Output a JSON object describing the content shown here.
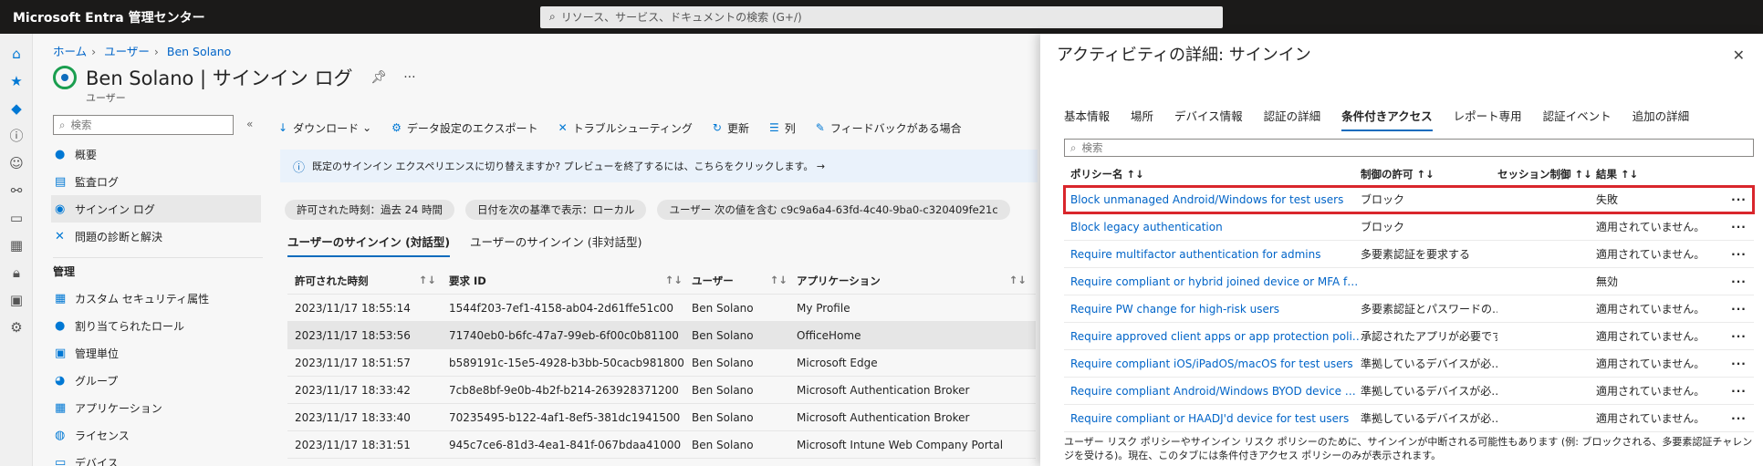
{
  "topbar": {
    "title": "Microsoft Entra 管理センター",
    "search_placeholder": "リソース、サービス、ドキュメントの検索 (G+/)"
  },
  "breadcrumb": [
    "ホーム",
    "ユーザー",
    "Ben Solano"
  ],
  "page": {
    "title": "Ben Solano | サインイン ログ",
    "subtitle": "ユーザー"
  },
  "nav": {
    "search_placeholder": "検索",
    "items": [
      "概要",
      "監査ログ",
      "サインイン ログ",
      "問題の診断と解決"
    ],
    "section": "管理",
    "manage_items": [
      "カスタム セキュリティ属性",
      "割り当てられたロール",
      "管理単位",
      "グループ",
      "アプリケーション",
      "ライセンス",
      "デバイス"
    ]
  },
  "toolbar": {
    "download": "ダウンロード",
    "export": "データ設定のエクスポート",
    "troubleshoot": "トラブルシューティング",
    "refresh": "更新",
    "columns": "列",
    "feedback": "フィードバックがある場合"
  },
  "info": "既定のサインイン エクスペリエンスに切り替えますか? プレビューを終了するには、こちらをクリックします。 →",
  "filters": [
    "許可された時刻：過去 24 時間",
    "日付を次の基準で表示：ローカル",
    "ユーザー 次の値を含む c9c9a6a4-63fd-4c40-9ba0-c320409fe21c"
  ],
  "list_tabs": [
    "ユーザーのサインイン (対話型)",
    "ユーザーのサインイン (非対話型)"
  ],
  "list": {
    "headers": [
      "許可された時刻",
      "要求 ID",
      "ユーザー",
      "アプリケーション"
    ],
    "rows": [
      [
        "2023/11/17 18:55:14",
        "1544f203-7ef1-4158-ab04-2d61ffe51c00",
        "Ben Solano",
        "My Profile"
      ],
      [
        "2023/11/17 18:53:56",
        "71740eb0-b6fc-47a7-99eb-6f00c0b81100",
        "Ben Solano",
        "OfficeHome"
      ],
      [
        "2023/11/17 18:51:57",
        "b589191c-15e5-4928-b3bb-50cacb981800",
        "Ben Solano",
        "Microsoft Edge"
      ],
      [
        "2023/11/17 18:33:42",
        "7cb8e8bf-9e0b-4b2f-b214-263928371200",
        "Ben Solano",
        "Microsoft Authentication Broker"
      ],
      [
        "2023/11/17 18:33:40",
        "70235495-b122-4af1-8ef5-381dc1941500",
        "Ben Solano",
        "Microsoft Authentication Broker"
      ],
      [
        "2023/11/17 18:31:51",
        "945c7ce6-81d3-4ea1-841f-067bdaa41000",
        "Ben Solano",
        "Microsoft Intune Web Company Portal"
      ]
    ]
  },
  "panel": {
    "title": "アクティビティの詳細: サインイン",
    "tabs": [
      "基本情報",
      "場所",
      "デバイス情報",
      "認証の詳細",
      "条件付きアクセス",
      "レポート専用",
      "認証イベント",
      "追加の詳細"
    ],
    "search_placeholder": "検索",
    "headers": [
      "ポリシー名",
      "制御の許可",
      "セッション制御",
      "結果"
    ],
    "rows": [
      [
        "Block unmanaged Android/Windows for test users",
        "ブロック",
        "",
        "失敗"
      ],
      [
        "Block legacy authentication",
        "ブロック",
        "",
        "適用されていません。"
      ],
      [
        "Require multifactor authentication for admins",
        "多要素認証を要求する",
        "",
        "適用されていません。"
      ],
      [
        "Require compliant or hybrid joined device or MFA f…",
        "",
        "",
        "無効"
      ],
      [
        "Require PW change for high-risk users",
        "多要素認証とパスワードの…",
        "",
        "適用されていません。"
      ],
      [
        "Require approved client apps or app protection poli…",
        "承認されたアプリが必要です",
        "",
        "適用されていません。"
      ],
      [
        "Require compliant iOS/iPadOS/macOS for test users",
        "準拠しているデバイスが必…",
        "",
        "適用されていません。"
      ],
      [
        "Require compliant Android/Windows BYOD device …",
        "準拠しているデバイスが必…",
        "",
        "適用されていません。"
      ],
      [
        "Require compliant or HAADJ'd device for test users",
        "準拠しているデバイスが必…",
        "",
        "適用されていません。"
      ]
    ],
    "note": "ユーザー リスク ポリシーやサインイン リスク ポリシーのために、サインインが中断される可能性もあります (例: ブロックされる、多要素認証チャレンジを受ける)。現在、このタブには条件付きアクセス ポリシーのみが表示されます。"
  }
}
